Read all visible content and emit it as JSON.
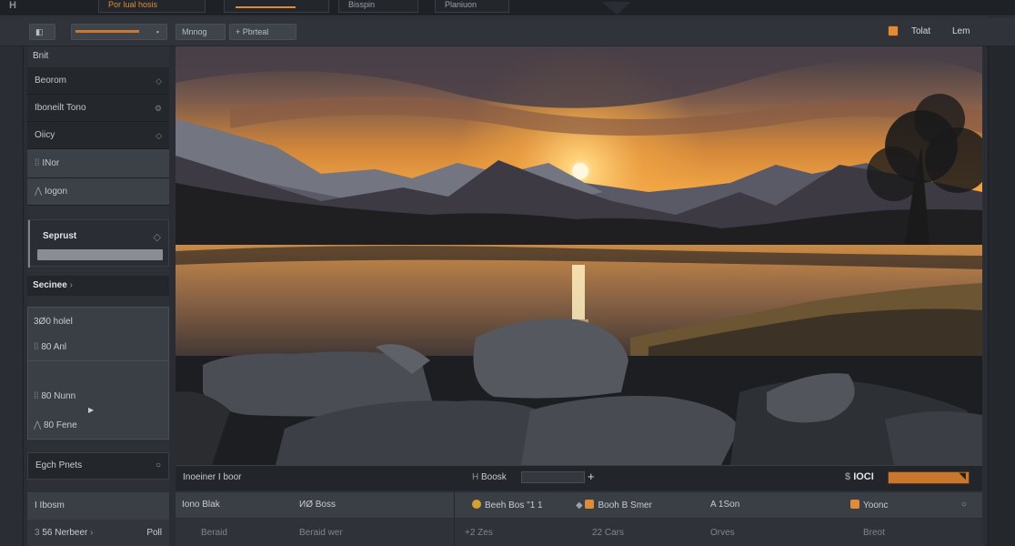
{
  "topbar": {
    "logo": "H",
    "tabs": [
      "Por lual hosis",
      "",
      "Bisspin",
      "Planiuon"
    ]
  },
  "toolbar": {
    "btn_left": "",
    "btn_filter1": "Mnnog",
    "btn_filter2": "Pbrteal",
    "btn_tolat": "Tolat",
    "btn_lem": "Lem"
  },
  "left_panel": {
    "header": "Bnit",
    "rows": [
      "Beorom",
      "Iboneilt Tono",
      "Oiicy"
    ],
    "selected_rows": [
      "INor",
      "Iogon"
    ],
    "section1_label": "Seprust",
    "section2_label": "Secinee",
    "group_items": [
      "3Ø0 holel",
      "80 Anl",
      "80 Nunn",
      "80 Fene"
    ],
    "egch": "Egch Pnets",
    "lbom": "I Ibosm",
    "bottom_left": "56 Nerbeer",
    "bottom_right": "Poll"
  },
  "status": {
    "left": "Inoeiner I boor",
    "center": "Boosk",
    "right": "IOCI"
  },
  "table": {
    "row1": [
      "Iono Blak",
      "ИØ Boss",
      "Beeh Bos \"1 1",
      "Booh B Smer",
      "A 1Son",
      "Yoonc"
    ],
    "row2": [
      "Beraid",
      "Beraid wer",
      "+2 Zes",
      "22 Cars",
      "Orves",
      "Breot"
    ]
  },
  "colors": {
    "accent": "#e08a3a",
    "panel": "#2d3137",
    "status_slider": "#c9772f"
  }
}
